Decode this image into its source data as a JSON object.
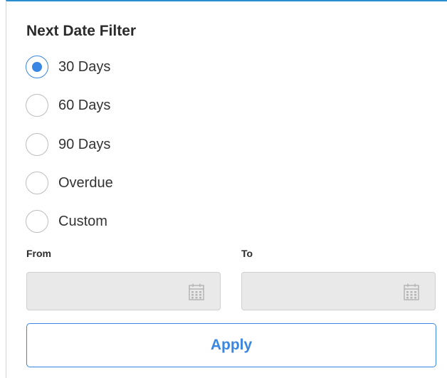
{
  "filter": {
    "title": "Next Date Filter",
    "options": [
      {
        "label": "30 Days",
        "checked": true
      },
      {
        "label": "60 Days",
        "checked": false
      },
      {
        "label": "90 Days",
        "checked": false
      },
      {
        "label": "Overdue",
        "checked": false
      },
      {
        "label": "Custom",
        "checked": false
      }
    ],
    "from_label": "From",
    "to_label": "To",
    "from_value": "",
    "to_value": "",
    "from_icon": "calendar-icon",
    "to_icon": "calendar-icon",
    "apply_label": "Apply"
  },
  "colors": {
    "accent": "#3a86e3",
    "top_border": "#2a8fcf",
    "input_bg": "#e9e9e9"
  }
}
